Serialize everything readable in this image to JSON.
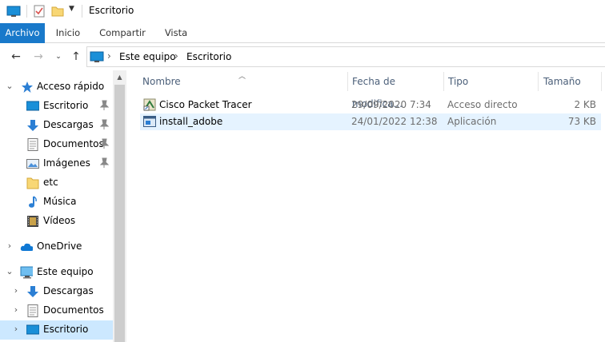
{
  "window": {
    "title": "Escritorio"
  },
  "ribbon": {
    "tabs": [
      "Archivo",
      "Inicio",
      "Compartir",
      "Vista"
    ]
  },
  "address": {
    "crumbs": [
      "Este equipo",
      "Escritorio"
    ]
  },
  "nav_pane": {
    "quick_access": "Acceso rápido",
    "quick_items": [
      "Escritorio",
      "Descargas",
      "Documentos",
      "Imágenes",
      "etc",
      "Música",
      "Vídeos"
    ],
    "onedrive": "OneDrive",
    "this_pc": "Este equipo",
    "pc_items": [
      "Descargas",
      "Documentos",
      "Escritorio"
    ]
  },
  "columns": [
    "Nombre",
    "Fecha de modifica...",
    "Tipo",
    "Tamaño"
  ],
  "files": [
    {
      "name": "Cisco Packet Tracer",
      "date": "29/09/2020 7:34",
      "type": "Acceso directo",
      "size": "2 KB"
    },
    {
      "name": "install_adobe",
      "date": "24/01/2022 12:38",
      "type": "Aplicación",
      "size": "73 KB"
    }
  ],
  "colors": {
    "accent": "#1979ca",
    "selection": "#cce8ff",
    "hover": "#e5f3ff"
  }
}
